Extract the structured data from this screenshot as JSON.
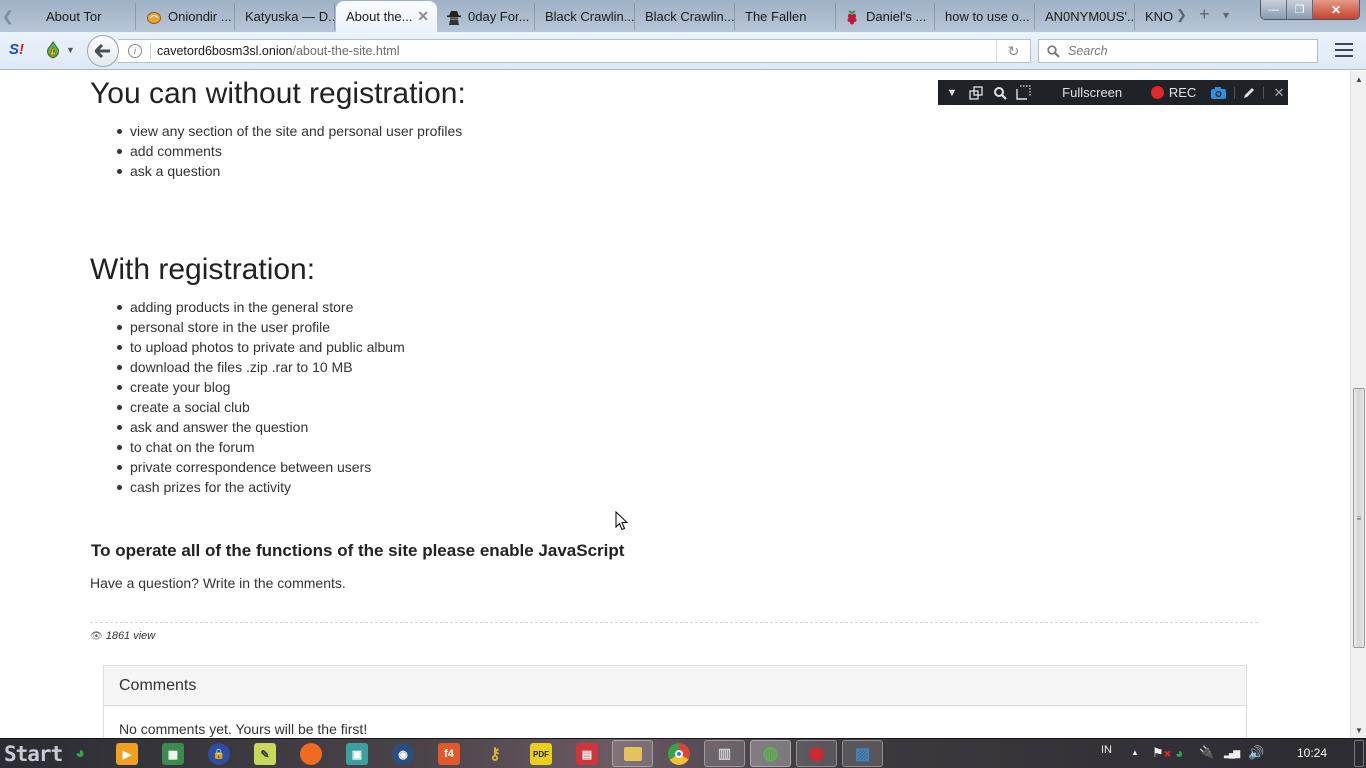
{
  "browser": {
    "tabs": [
      {
        "label": "About Tor",
        "icon": "none",
        "active": false
      },
      {
        "label": "Oniondir ...",
        "icon": "onion-icon",
        "active": false
      },
      {
        "label": "Katyuska — D...",
        "icon": "none",
        "active": false
      },
      {
        "label": "About the...",
        "icon": "none",
        "active": true
      },
      {
        "label": "0day For...",
        "icon": "spy-icon",
        "active": false
      },
      {
        "label": "Black Crawlin...",
        "icon": "none",
        "active": false
      },
      {
        "label": "Black Crawlin...",
        "icon": "none",
        "active": false
      },
      {
        "label": "The Fallen",
        "icon": "none",
        "active": false
      },
      {
        "label": "Daniel's ...",
        "icon": "raspberry-icon",
        "active": false
      },
      {
        "label": "how to use o...",
        "icon": "none",
        "active": false
      },
      {
        "label": "AN0NYM0US'...",
        "icon": "none",
        "active": false
      },
      {
        "label": "KNO",
        "icon": "none",
        "active": false
      }
    ],
    "tab_close_glyph": "✕",
    "new_tab_glyph": "+",
    "tab_list_glyph": "▾",
    "tab_scroll_right_glyph": "❯",
    "tab_scroll_left_glyph": "❮",
    "window_controls": {
      "minimize": "—",
      "maximize": "❐",
      "close": "✕"
    },
    "addon_s_label": "S",
    "addon_s_mark": "!",
    "back_glyph": "🡐",
    "info_glyph": "i",
    "url": {
      "domain": "cavetord6bosm3sl.onion",
      "path": "/about-the-site.html"
    },
    "reload_glyph": "↻",
    "search_placeholder": "Search",
    "search_glyph": "🔍"
  },
  "recorder_toolbar": {
    "dropdown_glyph": "▼",
    "window_glyph": "⧉",
    "zoom_glyph": "🔍",
    "region_glyph": "⬚",
    "fullscreen_label": "Fullscreen",
    "rec_label": "REC",
    "camera_glyph": "📷",
    "pen_glyph": "✎",
    "close_glyph": "✕",
    "rec_color": "#e0272a",
    "camera_color": "#2f8fe0"
  },
  "page": {
    "section_without": {
      "heading": "You can without registration:",
      "items": [
        "view any section of the site and personal user profiles",
        "add comments",
        "ask a question"
      ]
    },
    "section_with": {
      "heading": "With registration:",
      "items": [
        "adding products in the general store",
        "personal store in the user profile",
        "to upload photos to private and public album",
        "download the files .zip .rar to 10 MB",
        "create your blog",
        "create a social club",
        "ask and answer the question",
        "to chat on the forum",
        "private correspondence between users",
        "cash prizes for the activity"
      ]
    },
    "js_notice": "To operate all of the functions of the site please enable JavaScript",
    "question_text": "Have a question? Write in the comments.",
    "views_glyph": "👁",
    "views_text": "1861 view",
    "comments": {
      "title": "Comments",
      "empty_text": "No comments yet. Yours will be the first!"
    }
  },
  "scrollbar": {
    "up_glyph": "▲",
    "down_glyph": "▼",
    "grip_glyph": "≡",
    "scroll_position_fraction": 0.48
  },
  "taskbar": {
    "start_label": "Start",
    "apps": [
      {
        "name": "idm",
        "glyph": "◕",
        "color": "#3aa04a"
      },
      {
        "name": "media-player",
        "glyph": "▶",
        "color": "#f0a020"
      },
      {
        "name": "task-manager",
        "glyph": "▦",
        "color": "#3c8a4c"
      },
      {
        "name": "vpn-lock",
        "glyph": "🔒",
        "color": "#2d4fa3"
      },
      {
        "name": "notepad",
        "glyph": "✎",
        "color": "#c9d85a"
      },
      {
        "name": "firefox",
        "glyph": "●",
        "color": "#f06a20"
      },
      {
        "name": "display",
        "glyph": "▣",
        "color": "#3aa0a0"
      },
      {
        "name": "steam",
        "glyph": "◉",
        "color": "#2a4f7c"
      },
      {
        "name": "f4",
        "glyph": "f4",
        "color": "#e0592a"
      },
      {
        "name": "keys",
        "glyph": "⚷",
        "color": "#d9b730"
      },
      {
        "name": "pdf",
        "glyph": "PDF",
        "color": "#e8d019"
      },
      {
        "name": "presentation",
        "glyph": "▤",
        "color": "#d0353a"
      },
      {
        "name": "file-explorer",
        "glyph": "▭",
        "color": "#e7c25a"
      },
      {
        "name": "chrome",
        "glyph": "◎",
        "color": "#d6453a"
      },
      {
        "name": "remote-desktop",
        "glyph": "▥",
        "color": "#8b8b8b"
      },
      {
        "name": "tor-browser",
        "glyph": "◍",
        "color": "#5db24a"
      },
      {
        "name": "screen-recorder",
        "glyph": "◉",
        "color": "#d9252b"
      },
      {
        "name": "snipping-tool",
        "glyph": "▨",
        "color": "#3b87c9"
      }
    ],
    "tray": {
      "language": "IN",
      "show_hidden_glyph": "▲",
      "flag_glyph": "⚑",
      "idm_glyph": "◕",
      "power_glyph": "🔌",
      "signal_glyph": "▂▄▆",
      "volume_glyph": "🔊",
      "clock": "10:24"
    }
  }
}
